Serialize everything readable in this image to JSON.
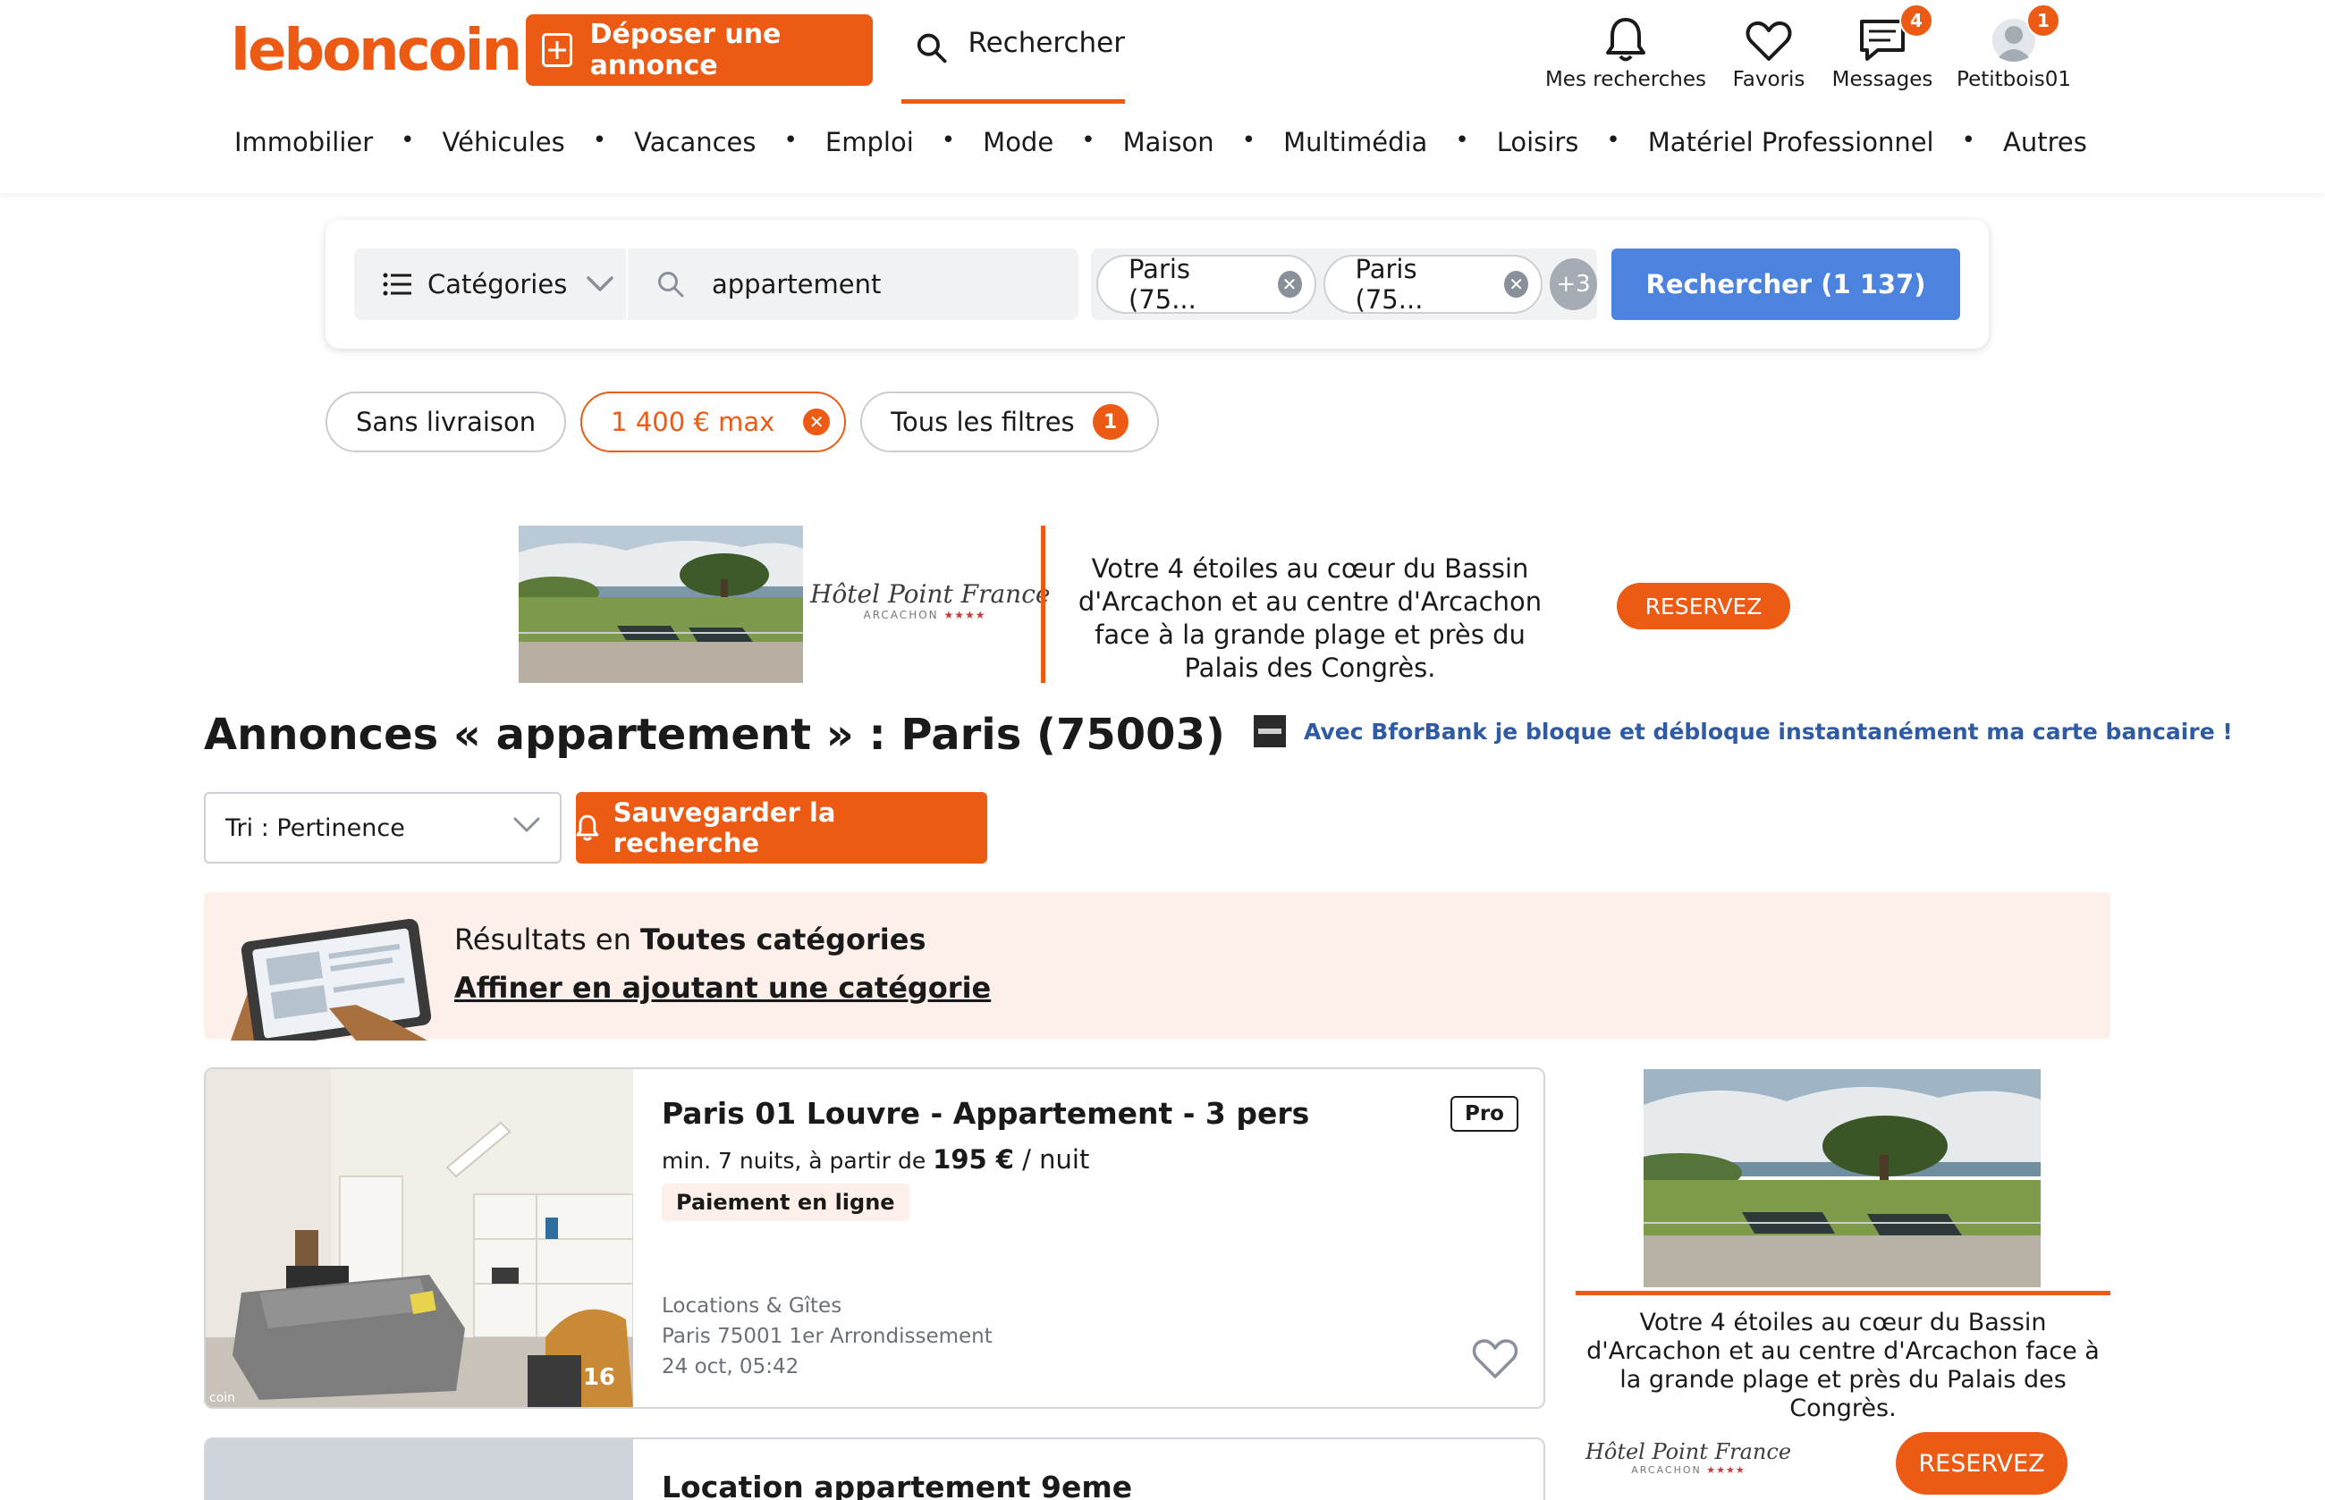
{
  "header": {
    "logo": "leboncoin",
    "post_ad_label": "Déposer une annonce",
    "search_tab_label": "Rechercher",
    "icons": [
      {
        "name": "bell-icon",
        "label": "Mes recherches",
        "badge": ""
      },
      {
        "name": "heart-icon",
        "label": "Favoris",
        "badge": ""
      },
      {
        "name": "message-icon",
        "label": "Messages",
        "badge": "4"
      },
      {
        "name": "avatar-icon",
        "label": "Petitbois01",
        "badge": "1"
      }
    ],
    "nav": [
      "Immobilier",
      "Véhicules",
      "Vacances",
      "Emploi",
      "Mode",
      "Maison",
      "Multimédia",
      "Loisirs",
      "Matériel Professionnel",
      "Autres"
    ],
    "nav_separator": "•"
  },
  "search": {
    "category_label": "Catégories",
    "keyword": "appartement",
    "locations": [
      "Paris (75...",
      "Paris (75..."
    ],
    "more_locations": "+3",
    "submit_label": "Rechercher (1 137)"
  },
  "filters": {
    "delivery": "Sans livraison",
    "price": "1 400 € max",
    "all_filters": "Tous les filtres",
    "all_filters_count": "1"
  },
  "banner_ad": {
    "hotel_name": "Hôtel Point France",
    "hotel_city": "ARCACHON",
    "hotel_stars": "★★★★",
    "text": "Votre 4 étoiles au cœur du Bassin d'Arcachon et au centre d'Arcachon face à la grande plage et près du Palais des Congrès.",
    "cta": "RESERVEZ"
  },
  "results": {
    "title": "Annonces « appartement » : Paris (75003)",
    "promo_text": "Avec BforBank je bloque et débloque instantanément ma carte bancaire !",
    "sort_label": "Tri : Pertinence",
    "save_search_label": "Sauvegarder la recherche",
    "category_info_prefix": "Résultats en ",
    "category_info_bold": "Toutes catégories",
    "category_refine": "Affiner en ajoutant une catégorie"
  },
  "listings": [
    {
      "title": "Paris 01 Louvre - Appartement - 3 pers",
      "price_prefix": "min. 7 nuits, à partir de ",
      "price_amount": "195 €",
      "price_unit": " / nuit",
      "tag": "Paiement en ligne",
      "pro": "Pro",
      "category": "Locations & Gîtes",
      "location": "Paris 75001 1er Arrondissement",
      "date": "24 oct, 05:42",
      "photo_count": "16",
      "watermark": "coin"
    },
    {
      "title": "Location appartement 9eme"
    }
  ],
  "side_ad": {
    "text": "Votre 4 étoiles au cœur du Bassin d'Arcachon et au centre d'Arcachon face à la grande plage et près du Palais des Congrès.",
    "hotel_name": "Hôtel Point France",
    "hotel_city": "ARCACHON",
    "hotel_stars": "★★★★",
    "cta": "RESERVEZ"
  },
  "colors": {
    "brand_orange": "#ec5a13",
    "search_blue": "#4b83de",
    "info_bg": "#fdf0ea",
    "promo_blue": "#2f5aa4"
  }
}
